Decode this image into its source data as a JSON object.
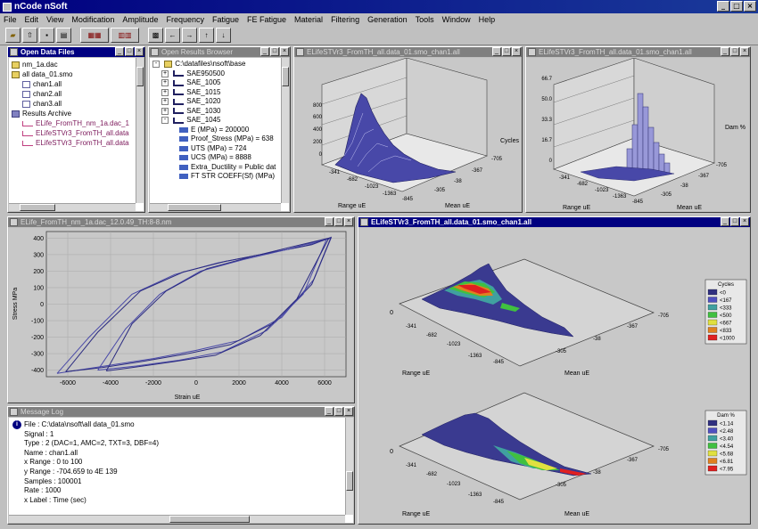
{
  "window": {
    "title": "nCode nSoft",
    "buttons": [
      "_",
      "□",
      "×"
    ]
  },
  "menu": [
    "File",
    "Edit",
    "View",
    "Modification",
    "Amplitude",
    "Frequency",
    "Fatigue",
    "FE Fatigue",
    "Material",
    "Filtering",
    "Generation",
    "Tools",
    "Window",
    "Help"
  ],
  "toolbar": {
    "buttons": [
      "Open",
      "Up",
      "Save",
      "Print",
      "Rainflow",
      "Cycles",
      "Plot",
      "←",
      "→",
      "↑",
      "↓"
    ]
  },
  "open_files": {
    "title": "Open Data Files",
    "items": [
      "nm_1a.dac",
      "all data_01.smo",
      "chan1.all",
      "chan2.all",
      "chan3.all",
      "Results Archive",
      "ELife_FromTH_nm_1a.dac_1",
      "ELifeSTVr3_FromTH_all.data",
      "ELifeSTVr3_FromTH_all.data"
    ]
  },
  "results_tree": {
    "title": "Open Results Browser",
    "items": [
      "C:\\datafiles\\nsoft\\base",
      "SAE950500",
      "SAE_1005",
      "SAE_1015",
      "SAE_1020",
      "SAE_1030",
      "SAE_1045",
      "E (MPa) = 200000",
      "Proof_Stress (MPa) = 638",
      "UTS (MPa) = 724",
      "UCS (MPa) = 8888",
      "Extra_Ductility = Public dat",
      "FT STR COEFF(Sf) (MPa)"
    ]
  },
  "hist1": {
    "title": "ELifeSTVr3_FromTH_all.data_01.smo_chan1.all",
    "z_label": "Cycles",
    "z_ticks": [
      "800",
      "600",
      "400",
      "200",
      "0"
    ],
    "x_ticks": [
      "-341",
      "-682",
      "-1023",
      "-1363",
      "-845"
    ],
    "y_ticks": [
      "-705",
      "-367",
      "-38",
      "-305"
    ],
    "x_label": "Range uE",
    "y_label": "Mean uE"
  },
  "hist2": {
    "title": "ELifeSTVr3_FromTH_all.data_01.smo_chan1.all",
    "z_label": "Dam %",
    "z_ticks": [
      "66.7",
      "50.0",
      "33.3",
      "16.7",
      "0"
    ],
    "x_ticks": [
      "-341",
      "-682",
      "-1023",
      "-1363",
      "-845"
    ],
    "y_ticks": [
      "-705",
      "-367",
      "-38",
      "-305"
    ],
    "x_label": "Range uE",
    "y_label": "Mean uE"
  },
  "hysteresis": {
    "title": "ELife_FromTH_nm_1a.dac_12.0.49_TH:8-8.nm",
    "chart_data": {
      "type": "line",
      "xlabel": "Strain uE",
      "ylabel": "Stress MPa",
      "xlim": [
        -7000,
        7000
      ],
      "ylim": [
        -440,
        440
      ],
      "x_ticks": [
        "-6000",
        "-4000",
        "-2000",
        "0",
        "2000",
        "4000",
        "6000"
      ],
      "y_ticks": [
        "400",
        "300",
        "200",
        "100",
        "0",
        "-100",
        "-200",
        "-300",
        "-400"
      ],
      "series": [
        {
          "x": [
            -6500,
            -5000,
            -3000,
            -1000,
            1000,
            3000,
            5000,
            6300,
            5500,
            4000,
            2000,
            0,
            -2000,
            -4000,
            -6000,
            -6500
          ],
          "y": [
            -420,
            -200,
            60,
            180,
            250,
            300,
            350,
            400,
            150,
            -80,
            -220,
            -280,
            -330,
            -370,
            -410,
            -420
          ]
        },
        {
          "x": [
            -6100,
            -4600,
            -2600,
            -600,
            1400,
            3400,
            5400,
            6300,
            5400,
            3700,
            1600,
            -400,
            -2400,
            -4400,
            -6100
          ],
          "y": [
            -410,
            -170,
            80,
            195,
            260,
            310,
            360,
            405,
            120,
            -110,
            -245,
            -300,
            -345,
            -385,
            -410
          ]
        },
        {
          "x": [
            -4600,
            -3300,
            -1700,
            200,
            2200,
            4200,
            6100,
            5000,
            3300,
            1200,
            -800,
            -2800,
            -4600
          ],
          "y": [
            -400,
            -150,
            60,
            200,
            270,
            330,
            395,
            60,
            -160,
            -290,
            -340,
            -375,
            -400
          ]
        },
        {
          "x": [
            -4200,
            -3000,
            -1400,
            500,
            2500,
            4400,
            6200,
            4700,
            3000,
            900,
            -1100,
            -3000,
            -4200
          ],
          "y": [
            -405,
            -120,
            80,
            215,
            285,
            345,
            400,
            30,
            -190,
            -310,
            -350,
            -385,
            -405
          ]
        }
      ]
    }
  },
  "message_log": {
    "title": "Message Log",
    "lines": [
      "File : C:\\data\\nsoft\\all data_01.smo",
      "Signal : 1",
      "Type : 2 (DAC=1, AMC=2, TXT=3, DBF=4)",
      "Name : chan1.all",
      "x Range : 0 to 100",
      "y Range : -704.659 to 4E 139",
      "Samples : 100001",
      "Rate : 1000",
      "x Label : Time (sec)"
    ]
  },
  "maps": {
    "title": "ELifeSTVr3_FromTH_all.data_01.smo_chan1.all",
    "top": {
      "legend_title": "Cycles",
      "legend_items": [
        "<0",
        "<167",
        "<333",
        "<500",
        "<667",
        "<833",
        "<1000"
      ],
      "x_ticks": [
        "-341",
        "-682",
        "-1023",
        "-1363",
        "-845"
      ],
      "y_ticks": [
        "-705",
        "-367",
        "-38",
        "-305"
      ],
      "x_label": "Range uE",
      "y_label": "Mean uE",
      "zero": "0"
    },
    "bottom": {
      "legend_title": "Dam %",
      "legend_items": [
        "<1.14",
        "<2.48",
        "<3.40",
        "<4.54",
        "<5.68",
        "<6.81",
        "<7.95"
      ],
      "x_ticks": [
        "-341",
        "-682",
        "-1023",
        "-1363",
        "-845"
      ],
      "y_ticks": [
        "-705",
        "-367",
        "-38",
        "-305"
      ],
      "x_label": "Range uE",
      "y_label": "Mean uE",
      "zero": "0"
    },
    "legend_colors": [
      "#303080",
      "#5050c0",
      "#40a0a0",
      "#40c040",
      "#e0e040",
      "#e08020",
      "#e02020"
    ]
  }
}
